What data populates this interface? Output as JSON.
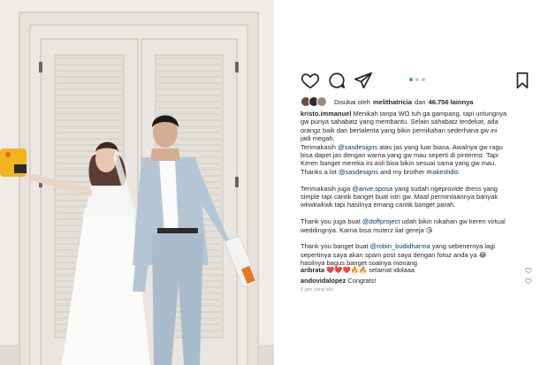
{
  "post": {
    "image_alt": "",
    "carousel": {
      "count": 3,
      "active": 0
    }
  },
  "actions": {
    "like_icon": "heart-icon",
    "comment_icon": "comment-icon",
    "share_icon": "share-icon",
    "save_icon": "bookmark-icon"
  },
  "likes": {
    "prefix": "Disukai oleh",
    "user": "melithatricia",
    "connector": "dan",
    "count_text": "46.756 lainnya"
  },
  "caption": {
    "username": "kristo.immanuel",
    "lines": [
      {
        "parts": [
          {
            "u": "kristo.immanuel"
          },
          {
            "t": " Menikah tanpa WO tuh ga gampang, tapi untungnya"
          }
        ]
      },
      {
        "parts": [
          {
            "t": "gw punya sahabatz yang membantu. Selain sahabatz terdekat, ada"
          }
        ]
      },
      {
        "parts": [
          {
            "t": "orangz baik dan bertalenta yang bikin pernikahan sederhana gw ini"
          }
        ]
      },
      {
        "parts": [
          {
            "t": "jadi megah."
          }
        ]
      },
      {
        "parts": [
          {
            "t": "Terimakasih "
          },
          {
            "tag": "@sasdesigns"
          },
          {
            "t": " atas jas yang luar biasa. Awalnya gw ragu"
          }
        ]
      },
      {
        "parts": [
          {
            "t": "bisa dapet jas dengan warna yang gw mau seperti di pinterest. Tapi"
          }
        ]
      },
      {
        "parts": [
          {
            "t": "Keren banget mereka ini asli bisa bikin sesuai sama yang gw mau."
          }
        ]
      },
      {
        "parts": [
          {
            "t": "Thanks a lot "
          },
          {
            "tag": "@sasdesigns"
          },
          {
            "t": " and my brother "
          },
          {
            "tag": "#rakeshdis"
          }
        ]
      },
      {
        "gap": true,
        "parts": []
      },
      {
        "parts": [
          {
            "t": "Terimakasih juga "
          },
          {
            "tag": "@anve.sposa"
          },
          {
            "t": " yang sudah ngeprovide dress yang"
          }
        ]
      },
      {
        "parts": [
          {
            "t": "simple tapi cantik banget buat istri gw. Maaf permintaannya banyak"
          }
        ]
      },
      {
        "parts": [
          {
            "t": "wkwkwkwk tapi hasilnya emang cantik banget parah."
          }
        ]
      },
      {
        "gap": true,
        "parts": []
      },
      {
        "parts": [
          {
            "t": "Thank you juga buat "
          },
          {
            "tag": "@doffproject"
          },
          {
            "t": " udah bikin nikahan gw keren virtual"
          }
        ]
      },
      {
        "parts": [
          {
            "t": "weddingnya. Karna bisa muterz liat gereja 😘"
          }
        ]
      },
      {
        "gap": true,
        "parts": []
      },
      {
        "parts": [
          {
            "t": "Thank you banget buat "
          },
          {
            "tag": "@robin_budidharma"
          },
          {
            "t": " yang sebenernya lagi"
          }
        ]
      },
      {
        "parts": [
          {
            "t": "sepertinya saya akan spam post saya dengan fotoz anda ya 😂"
          }
        ]
      },
      {
        "parts": [
          {
            "t": "hasilnya bagus banget soalnya monang"
          }
        ]
      }
    ]
  },
  "comments": [
    {
      "user": "aribrata",
      "text": " ❤️❤️❤️🔥🔥 selamat idolaaa"
    },
    {
      "user": "andovidalopez",
      "text": " Congrats!"
    }
  ],
  "timestamp": "5 jam yang lalu",
  "colors": {
    "link": "#003569",
    "dot_active": "#3897f0",
    "suit": "#b4c6d4"
  }
}
